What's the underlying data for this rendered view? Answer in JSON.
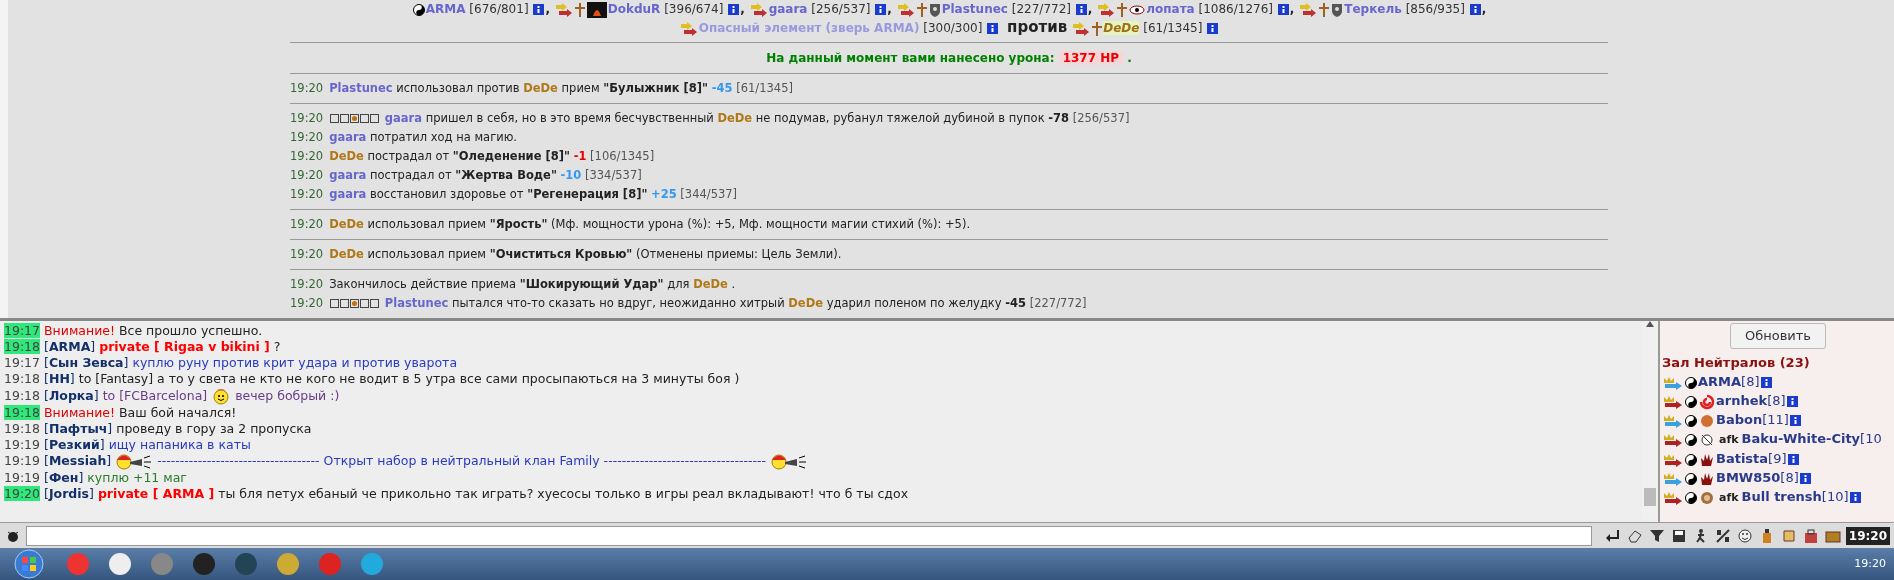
{
  "battle": {
    "lines": [
      [
        {
          "kind": "fighter",
          "color": "#6666cc",
          "icons": [
            {
              "kind": "yinyang"
            }
          ],
          "name": "ARMA",
          "hp": "[676/801]",
          "sep": ","
        },
        {
          "kind": "fighter",
          "color": "#6666cc",
          "icons": [
            {
              "kind": "arrow"
            },
            {
              "kind": "cross"
            },
            {
              "kind": "portrait"
            }
          ],
          "name": "DokduR",
          "hp": "[396/674]",
          "sep": ","
        },
        {
          "kind": "fighter",
          "color": "#6666cc",
          "icons": [
            {
              "kind": "arrow"
            }
          ],
          "name": "gaara",
          "hp": "[256/537]",
          "sep": ","
        },
        {
          "kind": "fighter",
          "color": "#6666cc",
          "icons": [
            {
              "kind": "arrow"
            },
            {
              "kind": "cross"
            },
            {
              "kind": "clan"
            }
          ],
          "name": "Plastunec",
          "hp": "[227/772]",
          "sep": ","
        },
        {
          "kind": "fighter",
          "color": "#6666cc",
          "icons": [
            {
              "kind": "arrow"
            },
            {
              "kind": "cross"
            },
            {
              "kind": "eye"
            }
          ],
          "name": "лопата",
          "hp": "[1086/1276]",
          "sep": ","
        },
        {
          "kind": "fighter",
          "color": "#6666cc",
          "icons": [
            {
              "kind": "arrow"
            },
            {
              "kind": "cross"
            },
            {
              "kind": "clan"
            }
          ],
          "name": "Теркель",
          "hp": "[856/935]",
          "sep": ","
        }
      ],
      [
        {
          "kind": "fighter",
          "color": "#9999dd",
          "icons": [
            {
              "kind": "arrow"
            }
          ],
          "name": "Опасный элемент (зверь ARMA)",
          "hp": "[300/300]"
        },
        {
          "kind": "versus",
          "text": "против"
        },
        {
          "kind": "enemy",
          "color": "#a07010",
          "icons": [
            {
              "kind": "arrow"
            },
            {
              "kind": "cross"
            }
          ],
          "name": "DeDe",
          "hp": "[61/1345]"
        }
      ]
    ],
    "damage": {
      "label": "На данный момент вами нанесено урона:",
      "value": "1377 HP",
      "end": "."
    },
    "log": [
      [
        {
          "time": "19:20",
          "parts": [
            {
              "kind": "p1",
              "t": "Plastunec"
            },
            {
              "kind": "text",
              "t": "использовал против"
            },
            {
              "kind": "p2",
              "t": "DeDe"
            },
            {
              "kind": "text",
              "t": "прием"
            },
            {
              "kind": "bold",
              "t": "\"Булыжник [8]\""
            },
            {
              "kind": "blue",
              "t": "-45"
            },
            {
              "kind": "hp",
              "t": "[61/1345]"
            }
          ]
        }
      ],
      [
        {
          "time": "19:20",
          "parts": [
            {
              "kind": "stance"
            },
            {
              "kind": "p1",
              "t": "gaara"
            },
            {
              "kind": "text",
              "t": "пришел в себя, но в это время бесчувственный"
            },
            {
              "kind": "p2",
              "t": "DeDe"
            },
            {
              "kind": "text",
              "t": "не подумав, рубанул тяжелой дубиной в пупок"
            },
            {
              "kind": "dark",
              "t": "-78"
            },
            {
              "kind": "hp",
              "t": "[256/537]"
            }
          ]
        },
        {
          "time": "19:20",
          "parts": [
            {
              "kind": "p1",
              "t": "gaara"
            },
            {
              "kind": "text",
              "t": "потратил ход на магию."
            }
          ]
        },
        {
          "time": "19:20",
          "parts": [
            {
              "kind": "p2",
              "t": "DeDe"
            },
            {
              "kind": "text",
              "t": "пострадал от"
            },
            {
              "kind": "bold",
              "t": "\"Оледенение [8]\""
            },
            {
              "kind": "red",
              "t": "-1"
            },
            {
              "kind": "hp",
              "t": "[106/1345]"
            }
          ]
        },
        {
          "time": "19:20",
          "parts": [
            {
              "kind": "p1",
              "t": "gaara"
            },
            {
              "kind": "text",
              "t": "пострадал от"
            },
            {
              "kind": "bold",
              "t": "\"Жертва Воде\""
            },
            {
              "kind": "blue",
              "t": "-10"
            },
            {
              "kind": "hp",
              "t": "[334/537]"
            }
          ]
        },
        {
          "time": "19:20",
          "parts": [
            {
              "kind": "p1",
              "t": "gaara"
            },
            {
              "kind": "text",
              "t": "восстановил здоровье от"
            },
            {
              "kind": "bold",
              "t": "\"Регенерация [8]\""
            },
            {
              "kind": "blue",
              "t": "+25"
            },
            {
              "kind": "hp",
              "t": "[344/537]"
            }
          ]
        }
      ],
      [
        {
          "time": "19:20",
          "parts": [
            {
              "kind": "p2",
              "t": "DeDe"
            },
            {
              "kind": "text",
              "t": "использовал прием"
            },
            {
              "kind": "bold",
              "t": "\"Ярость\""
            },
            {
              "kind": "text",
              "t": "(Мф. мощности урона (%): +5, Мф. мощности магии стихий (%): +5)."
            }
          ]
        }
      ],
      [
        {
          "time": "19:20",
          "parts": [
            {
              "kind": "p2",
              "t": "DeDe"
            },
            {
              "kind": "text",
              "t": "использовал прием"
            },
            {
              "kind": "bold",
              "t": "\"Очиститься Кровью\""
            },
            {
              "kind": "text",
              "t": "(Отменены приемы: Цель Земли)."
            }
          ]
        }
      ],
      [
        {
          "time": "19:20",
          "parts": [
            {
              "kind": "text",
              "t": "Закончилось действие приема"
            },
            {
              "kind": "bold",
              "t": "\"Шокирующий Удар\""
            },
            {
              "kind": "text",
              "t": "для"
            },
            {
              "kind": "p2",
              "t": "DeDe"
            },
            {
              "kind": "text",
              "t": "."
            }
          ]
        },
        {
          "time": "19:20",
          "parts": [
            {
              "kind": "stance"
            },
            {
              "kind": "p1",
              "t": "Plastunec"
            },
            {
              "kind": "text",
              "t": "пытался что-то сказать но вдруг, неожиданно хитрый"
            },
            {
              "kind": "p2",
              "t": "DeDe"
            },
            {
              "kind": "text",
              "t": "ударил поленом по желудку"
            },
            {
              "kind": "dark",
              "t": "-45"
            },
            {
              "kind": "hp",
              "t": "[227/772]"
            }
          ]
        }
      ]
    ]
  },
  "chat": {
    "messages": [
      {
        "time": "19:17",
        "highlighted": true,
        "parts": [
          {
            "kind": "alert",
            "t": "Внимание!"
          },
          {
            "kind": "plain",
            "t": "Все прошло успешно."
          }
        ]
      },
      {
        "time": "19:18",
        "highlighted": true,
        "parts": [
          {
            "kind": "sender",
            "t": "[**ARMA**]"
          },
          {
            "kind": "private",
            "t": "private [ Rigaa v bikini ]"
          },
          {
            "kind": "plain",
            "t": "?"
          }
        ]
      },
      {
        "time": "19:17",
        "highlighted": false,
        "parts": [
          {
            "kind": "sender",
            "t": "[**Сын Зевса**]"
          },
          {
            "kind": "blue",
            "t": "куплю руну против крит удара и против уварота"
          }
        ]
      },
      {
        "time": "19:18",
        "highlighted": false,
        "parts": [
          {
            "kind": "sender",
            "t": "[**HH**]"
          },
          {
            "kind": "plain",
            "t": "to [Fantasy] а то у света не кто не кого не водит в 5 утра все сами просыпаються на 3 минуты боя )"
          }
        ]
      },
      {
        "time": "19:18",
        "highlighted": false,
        "parts": [
          {
            "kind": "sender",
            "t": "[**Лорка**]"
          },
          {
            "kind": "purple",
            "t": "to [FCBarcelona]"
          },
          {
            "kind": "smiley"
          },
          {
            "kind": "purple",
            "t": "вечер бобрый :)"
          }
        ]
      },
      {
        "time": "19:18",
        "highlighted": true,
        "parts": [
          {
            "kind": "alert",
            "t": "Внимание!"
          },
          {
            "kind": "plain",
            "t": "Ваш бой начался!"
          }
        ]
      },
      {
        "time": "19:18",
        "highlighted": false,
        "parts": [
          {
            "kind": "sender",
            "t": "[**Пафтыч**]"
          },
          {
            "kind": "plain",
            "t": "проведу в гору за 2 пропуска"
          }
        ]
      },
      {
        "time": "19:19",
        "highlighted": false,
        "parts": [
          {
            "kind": "sender",
            "t": "[**Резкий**]"
          },
          {
            "kind": "blue",
            "t": "ищу напаника в каты"
          }
        ]
      },
      {
        "time": "19:19",
        "highlighted": false,
        "parts": [
          {
            "kind": "sender",
            "t": "[**Messiah**]"
          },
          {
            "kind": "megaphone"
          },
          {
            "kind": "blue",
            "t": "------------------------------------ Открыт набор в нейтральный клан Family ------------------------------------"
          },
          {
            "kind": "megaphone"
          }
        ]
      },
      {
        "time": "19:19",
        "highlighted": false,
        "parts": [
          {
            "kind": "sender",
            "t": "[**Фен**]"
          },
          {
            "kind": "green",
            "t": "куплю +11 маг"
          }
        ]
      },
      {
        "time": "19:20",
        "highlighted": true,
        "parts": [
          {
            "kind": "sender",
            "t": "[**Jordis**]"
          },
          {
            "kind": "private",
            "t": "private [ ARMA ]"
          },
          {
            "kind": "plain",
            "t": "ты бля петух ебаный че прикольно так играть? хуесосы только в игры реал вкладывают! что б ты сдох"
          }
        ]
      }
    ]
  },
  "room": {
    "refresh": "Обновить",
    "title": "Зал Нейтралов (23)",
    "users": [
      {
        "color": "#3aa0e0",
        "afk": false,
        "name": "ARMA",
        "level": "[8]"
      },
      {
        "color": "#b02020",
        "emblem": {
          "kind": "spiral"
        },
        "afk": false,
        "name": "arnhek",
        "level": "[8]"
      },
      {
        "color": "#3aa0e0",
        "emblem": {
          "kind": "orb"
        },
        "afk": false,
        "name": "Babon",
        "level": "[11]"
      },
      {
        "color": "#b02020",
        "emblem": {
          "kind": "mask"
        },
        "afk": true,
        "afk_text": "afk",
        "name": "Baku-White-City",
        "level": "[10"
      },
      {
        "color": "#b02020",
        "emblem": {
          "kind": "hand"
        },
        "afk": false,
        "name": "Batista",
        "level": "[9]"
      },
      {
        "color": "#3aa0e0",
        "emblem": {
          "kind": "hand"
        },
        "afk": false,
        "name": "BMW850",
        "level": "[8]"
      },
      {
        "color": "#b02020",
        "emblem": {
          "kind": "wreath"
        },
        "afk": true,
        "afk_text": "afk",
        "name": "Bull trensh",
        "level": "[10]"
      }
    ]
  },
  "toolbar": {
    "clock": "19:20"
  },
  "taskbar": {
    "time": "19:20"
  }
}
